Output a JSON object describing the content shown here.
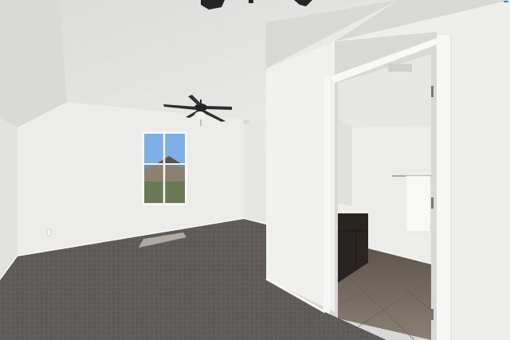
{
  "watermark": {
    "text": ""
  },
  "colors": {
    "carpet": "#5f5b58",
    "wall": "#eeeeec",
    "ceiling": "#e3e3e1",
    "cabinet": "#2b2521",
    "tile": "#7a6e62",
    "sky": "#5e93d6"
  }
}
